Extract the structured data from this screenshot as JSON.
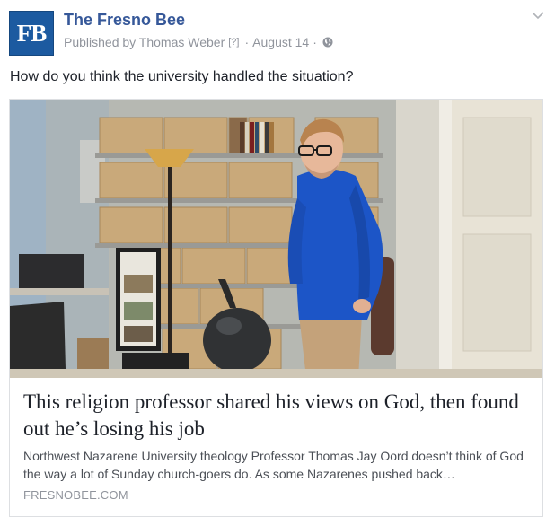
{
  "post": {
    "page_name": "The Fresno Bee",
    "avatar_text": "FB",
    "published_by": "Published by Thomas Weber",
    "help_marker": "[?]",
    "separator": "·",
    "date": "August 14",
    "audience_icon": "globe-icon",
    "menu_icon": "chevron-down-icon",
    "message": "How do you think the university handled the situation?"
  },
  "link": {
    "image_alt": "Professor in blue shirt standing in a small office with cardboard boxes on shelves",
    "headline": "This religion professor shared his views on God, then found out he’s losing his job",
    "description": "Northwest Nazarene University theology Professor Thomas Jay Oord doesn’t think of God the way a lot of Sunday church-goers do. As some Nazarenes pushed back…",
    "domain": "FRESNOBEE.COM"
  },
  "colors": {
    "brand_blue": "#1c5aa0",
    "link_blue": "#365899",
    "meta_gray": "#90949c",
    "text": "#1d2129",
    "border": "#dddfe2"
  }
}
